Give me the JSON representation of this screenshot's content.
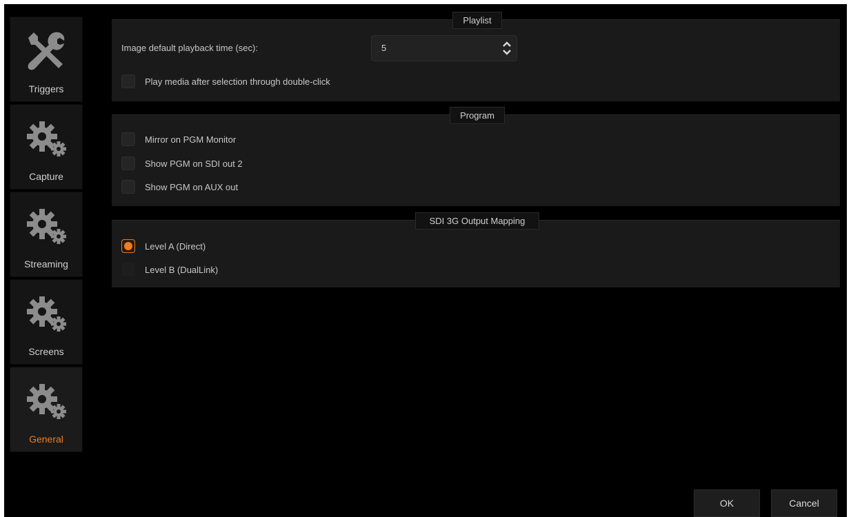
{
  "sidebar": {
    "items": [
      {
        "label": "Triggers",
        "icon": "tools-icon",
        "active": false
      },
      {
        "label": "Capture",
        "icon": "gears-icon",
        "active": false
      },
      {
        "label": "Streaming",
        "icon": "gears-icon",
        "active": false
      },
      {
        "label": "Screens",
        "icon": "gears-icon",
        "active": false
      },
      {
        "label": "General",
        "icon": "gears-icon",
        "active": true
      }
    ]
  },
  "playlist": {
    "title": "Playlist",
    "playback_label": "Image default playback time (sec):",
    "playback_value": "5",
    "double_click_label": "Play media after selection through double-click",
    "double_click_checked": false
  },
  "program": {
    "title": "Program",
    "options": [
      {
        "label": "Mirror on PGM Monitor",
        "checked": false
      },
      {
        "label": "Show PGM on SDI out 2",
        "checked": false
      },
      {
        "label": "Show PGM on AUX out",
        "checked": false
      }
    ]
  },
  "sdi_mapping": {
    "title": "SDI 3G Output Mapping",
    "options": [
      {
        "label": "Level A (Direct)",
        "selected": true
      },
      {
        "label": "Level B (DualLink)",
        "selected": false
      }
    ]
  },
  "footer": {
    "ok_label": "OK",
    "cancel_label": "Cancel"
  },
  "colors": {
    "accent": "#ef7d22",
    "background": "#000000",
    "panel": "#1a1a1a"
  }
}
